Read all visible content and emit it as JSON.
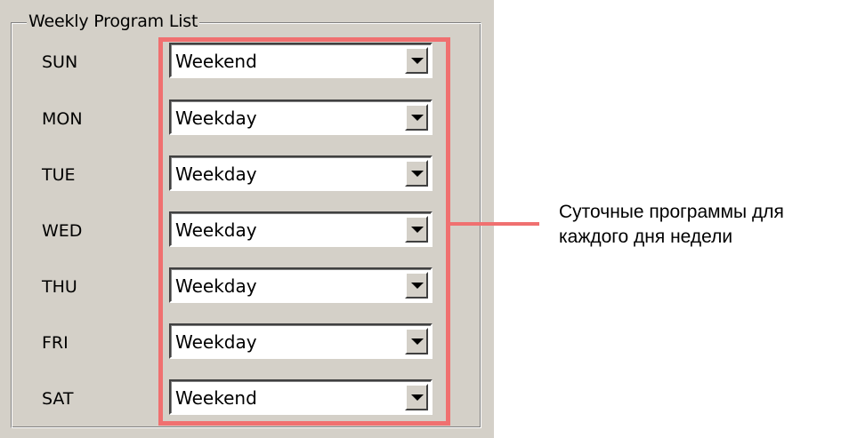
{
  "group": {
    "title": "Weekly Program List"
  },
  "days": [
    {
      "label": "SUN",
      "program": "Weekend"
    },
    {
      "label": "MON",
      "program": "Weekday"
    },
    {
      "label": "TUE",
      "program": "Weekday"
    },
    {
      "label": "WED",
      "program": "Weekday"
    },
    {
      "label": "THU",
      "program": "Weekday"
    },
    {
      "label": "FRI",
      "program": "Weekday"
    },
    {
      "label": "SAT",
      "program": "Weekend"
    }
  ],
  "annotation": {
    "line1": "Суточные программы для",
    "line2": "каждого дня недели",
    "color": "#f07070"
  },
  "icons": {
    "dropdown": "chevron-down-icon"
  }
}
